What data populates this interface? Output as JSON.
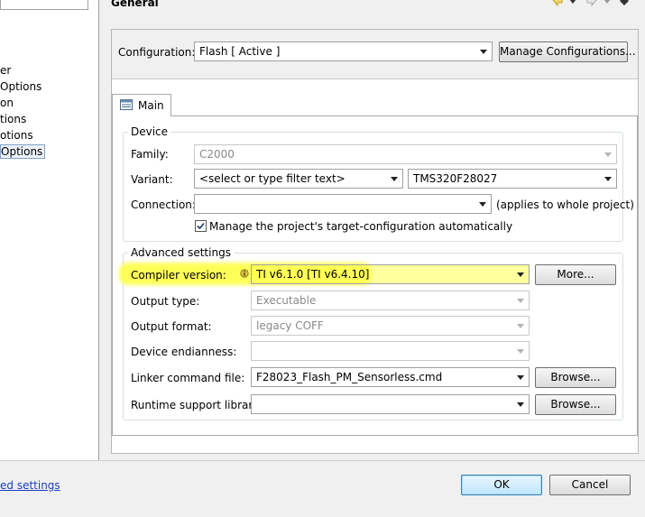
{
  "left_tree": {
    "items": [
      {
        "label": "er"
      },
      {
        "label": "Options"
      },
      {
        "label": "on"
      },
      {
        "label": "tions"
      },
      {
        "label": "otions"
      },
      {
        "label": "Options"
      }
    ],
    "link": "ed settings"
  },
  "header": {
    "title": "General"
  },
  "configuration": {
    "label": "Configuration:",
    "value": "Flash  [ Active ]",
    "manage_button": "Manage Configurations..."
  },
  "tabs": [
    {
      "label": "Main"
    }
  ],
  "device": {
    "title": "Device",
    "family_label": "Family:",
    "family_value": "C2000",
    "variant_label": "Variant:",
    "variant_filter": "<select or type filter text>",
    "variant_value": "TMS320F28027",
    "connection_label": "Connection:",
    "connection_value": "",
    "connection_note": "(applies to whole project)",
    "manage_checkbox_label": "Manage the project's target-configuration automatically",
    "manage_checked": true
  },
  "advanced": {
    "title": "Advanced settings",
    "compiler_label": "Compiler version:",
    "compiler_value": "TI v6.1.0  [TI v6.4.10]",
    "more_button": "More...",
    "output_type_label": "Output type:",
    "output_type_value": "Executable",
    "output_format_label": "Output format:",
    "output_format_value": "legacy COFF",
    "endianness_label": "Device endianness:",
    "endianness_value": "",
    "linker_label": "Linker command file:",
    "linker_value": "F28023_Flash_PM_Sensorless.cmd",
    "browse_button": "Browse...",
    "runtime_label": "Runtime support library:",
    "runtime_value": "",
    "browse2_button": "Browse..."
  },
  "footer": {
    "ok": "OK",
    "cancel": "Cancel"
  },
  "colors": {
    "highlight": "#ffff3c",
    "link": "#1a3ec9",
    "default_button": "#bee6fd"
  }
}
